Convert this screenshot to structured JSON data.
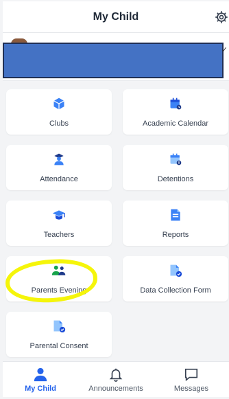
{
  "header": {
    "title": "My Child"
  },
  "tiles": [
    {
      "label": "Clubs",
      "icon": "clubs-cube-icon"
    },
    {
      "label": "Academic Calendar",
      "icon": "calendar-icon"
    },
    {
      "label": "Attendance",
      "icon": "attendance-person-icon"
    },
    {
      "label": "Detentions",
      "icon": "detentions-calendar-alert-icon"
    },
    {
      "label": "Teachers",
      "icon": "mortarboard-icon"
    },
    {
      "label": "Reports",
      "icon": "report-document-icon"
    },
    {
      "label": "Parents Evening",
      "icon": "parents-group-icon"
    },
    {
      "label": "Data Collection Form",
      "icon": "form-document-check-icon"
    },
    {
      "label": "Parental Consent",
      "icon": "consent-document-check-icon"
    }
  ],
  "tabbar": {
    "items": [
      {
        "label": "My Child",
        "icon": "person-icon",
        "active": true
      },
      {
        "label": "Announcements",
        "icon": "bell-icon",
        "active": false
      },
      {
        "label": "Messages",
        "icon": "message-bubble-icon",
        "active": false
      }
    ]
  },
  "colors": {
    "accent": "#2563eb",
    "icon_blue": "#3b82f6",
    "icon_green": "#16a34a",
    "highlight": "#f5f50a",
    "redaction": "#4472c4"
  }
}
